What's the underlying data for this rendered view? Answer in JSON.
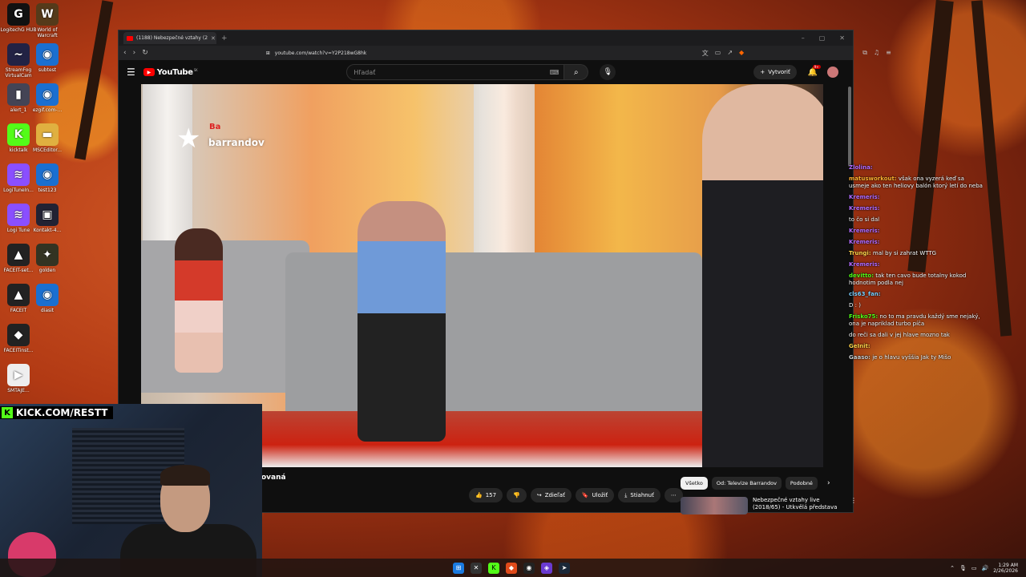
{
  "desktop": {
    "icons": [
      {
        "label": "LogitechG HUB",
        "glyph": "G",
        "color": "#111"
      },
      {
        "label": "World of Warcraft",
        "glyph": "W",
        "color": "#553a1a"
      },
      {
        "label": "StreamFog VirtualCam",
        "glyph": "~",
        "color": "#224"
      },
      {
        "label": "subtest",
        "glyph": "◉",
        "color": "#1a6fd0"
      },
      {
        "label": "alert_1",
        "glyph": "▮",
        "color": "#445"
      },
      {
        "label": "ezgif.com-...",
        "glyph": "◉",
        "color": "#1a6fd0"
      },
      {
        "label": "kicktalk",
        "glyph": "K",
        "color": "#53fc18"
      },
      {
        "label": "MSCEditor...",
        "glyph": "▬",
        "color": "#e0b040"
      },
      {
        "label": "LogiTuneIn...",
        "glyph": "≋",
        "color": "#8a4fff"
      },
      {
        "label": "test123",
        "glyph": "◉",
        "color": "#1a6fd0"
      },
      {
        "label": "Logi Tune",
        "glyph": "≋",
        "color": "#8a4fff"
      },
      {
        "label": "Kontakt-4...",
        "glyph": "▣",
        "color": "#223"
      },
      {
        "label": "FACEIT-set...",
        "glyph": "▲",
        "color": "#222"
      },
      {
        "label": "golden",
        "glyph": "✦",
        "color": "#332"
      },
      {
        "label": "FACEIT",
        "glyph": "▲",
        "color": "#222"
      },
      {
        "label": "diasit",
        "glyph": "◉",
        "color": "#1a6fd0"
      },
      {
        "label": "FACEITinst...",
        "glyph": "◆",
        "color": "#222"
      },
      {
        "label": "",
        "glyph": "",
        "color": "transparent"
      },
      {
        "label": "SMTAJE...",
        "glyph": "▶",
        "color": "#eee"
      }
    ]
  },
  "browser": {
    "tab_title": "(1188) Nebezpečné vztahy (2",
    "url": "youtube.com/watch?v=Y2P218wG8hk"
  },
  "youtube": {
    "logo_text": "YouTube",
    "logo_sup": "SK",
    "search_placeholder": "Hľadať",
    "create_label": "Vytvoriť",
    "notif_badge": "9+",
    "video_title": "ovaná",
    "channel_logo": "barrandov",
    "channel_tag": "Ba",
    "actions": {
      "likes": "157",
      "share": "Zdieľať",
      "save": "Uložiť",
      "download": "Stiahnuť"
    },
    "chips": [
      "Všetko",
      "Od: Televize Barrandov",
      "Podobné"
    ],
    "recommendation": {
      "title": "Nebezpečné vztahy live (2018/65) - Utkvělá představa"
    }
  },
  "chat": [
    {
      "user": "Zlolina:",
      "color": "#b46cff",
      "text": ""
    },
    {
      "user": "matusworkout:",
      "color": "#ffb030",
      "text": "však ona vyzerá keď sa usmeje ako ten heliovy balón ktorý letí do neba"
    },
    {
      "user": "Kremeris:",
      "color": "#b46cff",
      "text": ""
    },
    {
      "user": "Kremeris:",
      "color": "#b46cff",
      "text": ""
    },
    {
      "user": "",
      "color": "#b46cff",
      "text": "to čo si dal"
    },
    {
      "user": "Kremeris:",
      "color": "#b46cff",
      "text": ""
    },
    {
      "user": "Kremeris:",
      "color": "#b46cff",
      "text": ""
    },
    {
      "user": "Trungi:",
      "color": "#ffd24a",
      "text": "mal by si zahrat WTTG"
    },
    {
      "user": "Kremeris:",
      "color": "#b46cff",
      "text": ""
    },
    {
      "user": "devitto:",
      "color": "#53fc18",
      "text": "tak ten cavo bude totalny kokod hodnotim podla nej"
    },
    {
      "user": "cls63_fan:",
      "color": "#7ad0ff",
      "text": ""
    },
    {
      "user": "",
      "color": "#b46cff",
      "text": "D : )"
    },
    {
      "user": "Frisko75:",
      "color": "#53fc18",
      "text": "no to ma pravdu každý sme nejaký, ona je napriklad turbo píča"
    },
    {
      "user": "",
      "color": "#b46cff",
      "text": "do reči sa dali v jej hlave mozno tak"
    },
    {
      "user": "GeInit:",
      "color": "#ffd24a",
      "text": ""
    },
    {
      "user": "Gaaso:",
      "color": "#cccccc",
      "text": "je o hlavu vyššia Jak ty Mišo"
    }
  ],
  "stream_overlay": {
    "kick_url": "KICK.COM/RESTT"
  },
  "taskbar": {
    "time": "1:29 AM",
    "date": "2/26/2026"
  }
}
